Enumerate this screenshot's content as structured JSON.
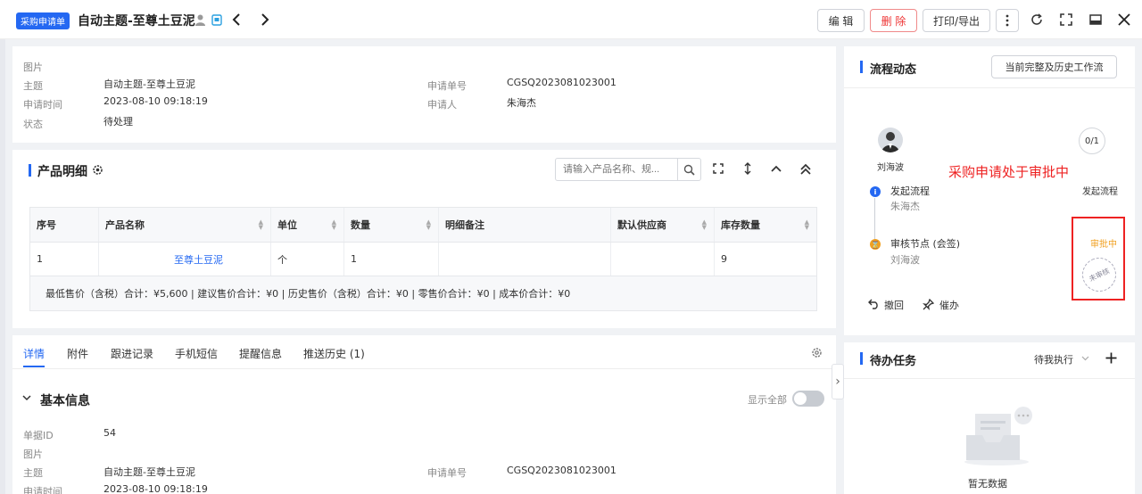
{
  "header": {
    "badge": "采购申请单",
    "title": "自动主题-至尊土豆泥",
    "buttons": {
      "edit": "编 辑",
      "delete": "删 除",
      "print": "打印/导出"
    },
    "colors": {
      "primary": "#2468f2",
      "danger": "#e33333"
    }
  },
  "summary_info": {
    "image_label": "图片",
    "subject_label": "主题",
    "subject_value": "自动主题-至尊土豆泥",
    "time_label": "申请时间",
    "time_value": "2023-08-10 09:18:19",
    "status_label": "状态",
    "status_value": "待处理",
    "no_label": "申请单号",
    "no_value": "CGSQ2023081023001",
    "applicant_label": "申请人",
    "applicant_value": "朱海杰"
  },
  "products": {
    "title": "产品明细",
    "search_placeholder": "请输入产品名称、规...",
    "columns": [
      "序号",
      "产品名称",
      "单位",
      "数量",
      "明细备注",
      "默认供应商",
      "库存数量"
    ],
    "rows": [
      {
        "index": "1",
        "name": "至尊土豆泥",
        "unit": "个",
        "qty": "1",
        "note": "",
        "supplier": "",
        "stock": "9"
      }
    ],
    "summary": "最低售价（含税）合计：¥5,600 |   建议售价合计：¥0 |   历史售价（含税）合计：¥0 |   零售价合计：¥0 |   成本价合计：¥0"
  },
  "tabs": [
    {
      "label": "详情",
      "active": true
    },
    {
      "label": "附件"
    },
    {
      "label": "跟进记录"
    },
    {
      "label": "手机短信"
    },
    {
      "label": "提醒信息"
    },
    {
      "label": "推送历史 (1)"
    }
  ],
  "basic_info": {
    "title": "基本信息",
    "show_all": "显示全部",
    "id_label": "单据ID",
    "id_value": "54",
    "image_label": "图片",
    "subject_label": "主题",
    "subject_value": "自动主题-至尊土豆泥",
    "no_label": "申请单号",
    "no_value": "CGSQ2023081023001",
    "time_label": "申请时间",
    "time_value": "2023-08-10 09:18:19"
  },
  "workflow": {
    "title": "流程动态",
    "history_button": "当前完整及历史工作流",
    "approver": "刘海波",
    "count": "0/1",
    "annotation": "采购申请处于审批中",
    "steps": [
      {
        "name": "发起流程",
        "person": "朱海杰",
        "status": "发起流程"
      },
      {
        "name": "审核节点 (会签)",
        "person": "刘海波",
        "status": "审批中"
      }
    ],
    "stamp": "未审核",
    "withdraw": "撤回",
    "remind": "催办",
    "colors": {
      "pending": "#f0a020",
      "start": "#2468f2"
    }
  },
  "tasks": {
    "title": "待办任务",
    "filter": "待我执行",
    "empty": "暂无数据"
  }
}
